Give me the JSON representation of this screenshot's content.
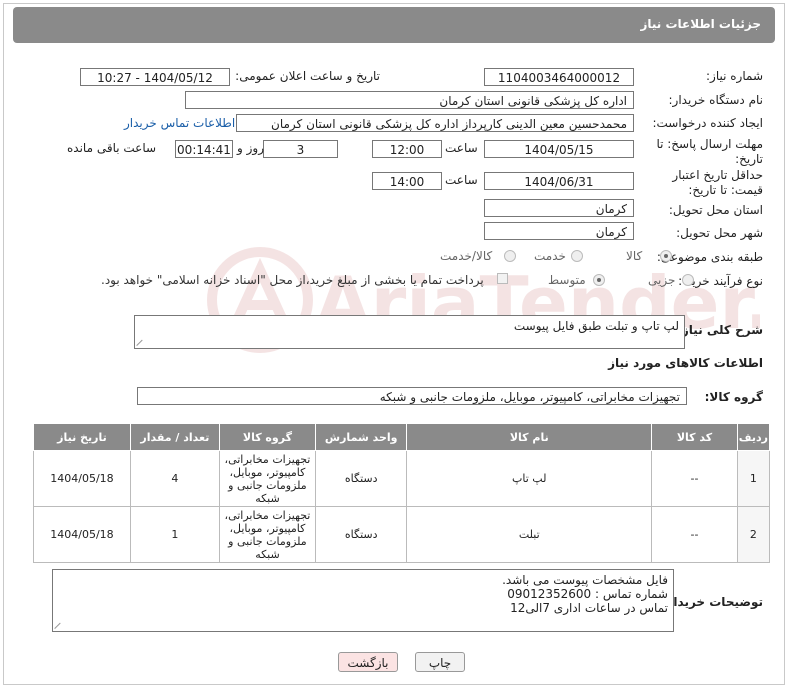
{
  "header": {
    "title": "جزئیات اطلاعات نیاز"
  },
  "form": {
    "need_number": {
      "label": "شماره نیاز:",
      "value": "1104003464000012"
    },
    "announce": {
      "label": "تاریخ و ساعت اعلان عمومی:",
      "value": "1404/05/12 - 10:27"
    },
    "buyer_org": {
      "label": "نام دستگاه خریدار:",
      "value": "اداره کل پزشکی قانونی استان کرمان"
    },
    "requester": {
      "label": "ایجاد کننده درخواست:",
      "value": "محمدحسین معین الدینی کارپرداز اداره کل پزشکی قانونی استان کرمان",
      "contact_link": "اطلاعات تماس خریدار"
    },
    "reply_deadline": {
      "label": "مهلت ارسال پاسخ: تا تاریخ:",
      "date": "1404/05/15",
      "time_label": "ساعت",
      "time": "12:00",
      "days": "3",
      "days_label": "روز و",
      "remaining": "00:14:41",
      "remaining_label": "ساعت باقی مانده"
    },
    "price_validity": {
      "label": "حداقل تاریخ اعتبار قیمت: تا تاریخ:",
      "date": "1404/06/31",
      "time_label": "ساعت",
      "time": "14:00"
    },
    "delivery_province": {
      "label": "استان محل تحویل:",
      "value": "کرمان"
    },
    "delivery_city": {
      "label": "شهر محل تحویل:",
      "value": "کرمان"
    },
    "category": {
      "label": "طبقه بندی موضوعی:",
      "options": [
        "کالا",
        "خدمت",
        "کالا/خدمت"
      ],
      "selected": "کالا"
    },
    "process_type": {
      "label": "نوع فرآیند خرید :",
      "options": [
        "جزیی",
        "متوسط"
      ],
      "selected": "متوسط",
      "payment_note": "پرداخت تمام یا بخشی از مبلغ خرید،از محل \"اسناد خزانه اسلامی\" خواهد بود."
    }
  },
  "description": {
    "label": "شرح کلی نیاز:",
    "value": "لپ تاپ و تبلت طبق فایل پیوست"
  },
  "goods_info": {
    "title": "اطلاعات کالاهای مورد نیاز",
    "group_label": "گروه کالا:",
    "group_value": "تجهیزات مخابراتی، کامپیوتر، موبایل، ملزومات جانبی و شبکه"
  },
  "table": {
    "headers": [
      "ردیف",
      "کد کالا",
      "نام کالا",
      "واحد شمارش",
      "گروه کالا",
      "تعداد / مقدار",
      "تاریخ نیاز"
    ],
    "rows": [
      {
        "row": "1",
        "code": "--",
        "name": "لپ تاپ",
        "unit": "دستگاه",
        "group": "تجهیزات مخابراتی، کامپیوتر، موبایل، ملزومات جانبی و شبکه",
        "qty": "4",
        "date": "1404/05/18"
      },
      {
        "row": "2",
        "code": "--",
        "name": "تبلت",
        "unit": "دستگاه",
        "group": "تجهیزات مخابراتی، کامپیوتر، موبایل، ملزومات جانبی و شبکه",
        "qty": "1",
        "date": "1404/05/18"
      }
    ]
  },
  "buyer_notes": {
    "label": "توضیحات خریدار:",
    "lines": [
      "فایل مشخصات پیوست می باشد.",
      "شماره تماس : 09012352600",
      "تماس در ساعات اداری 7الی12"
    ]
  },
  "buttons": {
    "print": "چاپ",
    "back": "بازگشت"
  },
  "colors": {
    "header_bg": "#8a8a8a",
    "link": "#1a5ea8",
    "back_button_bg": "#fbe3e3"
  }
}
